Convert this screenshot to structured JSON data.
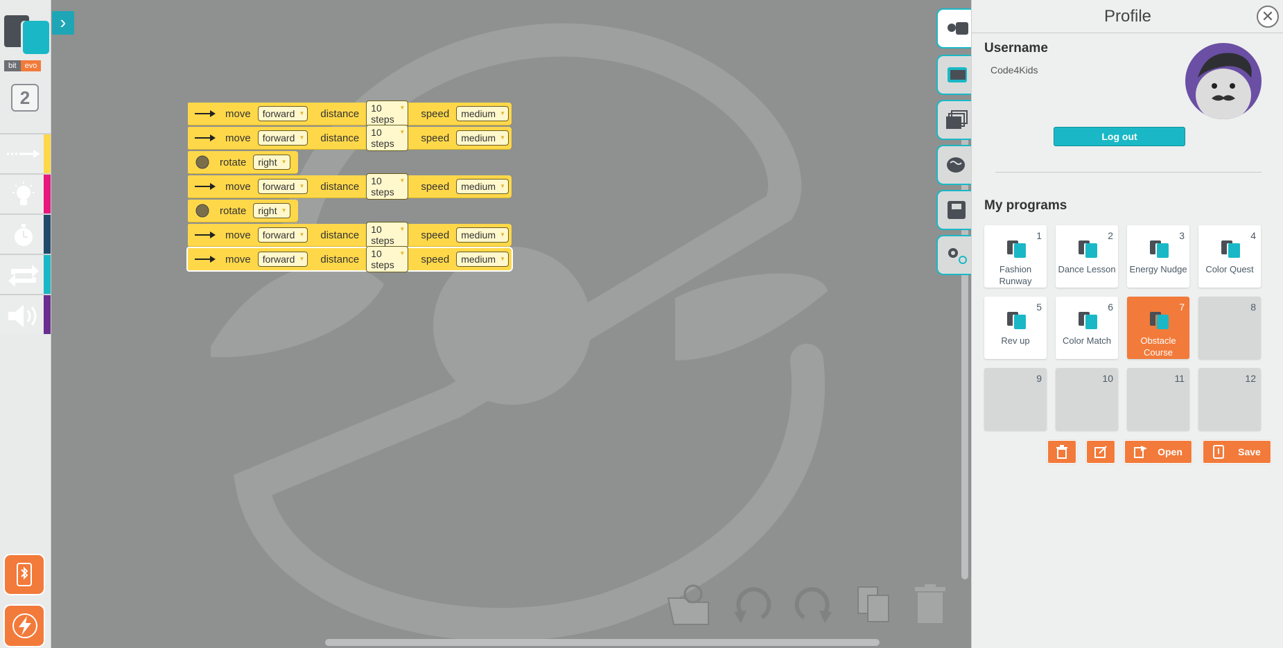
{
  "app": {
    "brand_left": "bit",
    "brand_right": "evo",
    "level": "2"
  },
  "colors": {
    "accent_teal": "#1ab8c6",
    "accent_orange": "#f27a3a",
    "block_yellow": "#ffd84a",
    "canvas_gray": "#8e9190",
    "cat_move": "#ffd84a",
    "cat_light": "#e8167d",
    "cat_timer": "#1f4a6b",
    "cat_loop": "#1ab8c6",
    "cat_sound": "#6b2d8f"
  },
  "categories": [
    {
      "name": "move",
      "icon": "arrow-right-icon"
    },
    {
      "name": "light",
      "icon": "bulb-icon"
    },
    {
      "name": "timer",
      "icon": "stopwatch-icon"
    },
    {
      "name": "loop",
      "icon": "repeat-icon"
    },
    {
      "name": "sound",
      "icon": "speaker-icon"
    }
  ],
  "blocks": [
    {
      "type": "move",
      "cmd": "move",
      "direction": "forward",
      "distance_label": "distance",
      "distance": "10 steps",
      "speed_label": "speed",
      "speed": "medium"
    },
    {
      "type": "move",
      "cmd": "move",
      "direction": "forward",
      "distance_label": "distance",
      "distance": "10 steps",
      "speed_label": "speed",
      "speed": "medium"
    },
    {
      "type": "rotate",
      "cmd": "rotate",
      "direction": "right"
    },
    {
      "type": "move",
      "cmd": "move",
      "direction": "forward",
      "distance_label": "distance",
      "distance": "10 steps",
      "speed_label": "speed",
      "speed": "medium"
    },
    {
      "type": "rotate",
      "cmd": "rotate",
      "direction": "right"
    },
    {
      "type": "move",
      "cmd": "move",
      "direction": "forward",
      "distance_label": "distance",
      "distance": "10 steps",
      "speed_label": "speed",
      "speed": "medium"
    },
    {
      "type": "move",
      "cmd": "move",
      "direction": "forward",
      "distance_label": "distance",
      "distance": "10 steps",
      "speed_label": "speed",
      "speed": "medium"
    }
  ],
  "profile": {
    "title": "Profile",
    "close": "✕",
    "username_label": "Username",
    "username": "Code4Kids",
    "logout": "Log out",
    "programs_title": "My programs",
    "programs": [
      {
        "num": "1",
        "name": "Fashion Runway"
      },
      {
        "num": "2",
        "name": "Dance Lesson"
      },
      {
        "num": "3",
        "name": "Energy Nudge"
      },
      {
        "num": "4",
        "name": "Color Quest"
      },
      {
        "num": "5",
        "name": "Rev up"
      },
      {
        "num": "6",
        "name": "Color Match"
      },
      {
        "num": "7",
        "name": "Obstacle Course",
        "active": true
      },
      {
        "num": "8",
        "name": ""
      },
      {
        "num": "9",
        "name": ""
      },
      {
        "num": "10",
        "name": ""
      },
      {
        "num": "11",
        "name": ""
      },
      {
        "num": "12",
        "name": ""
      }
    ],
    "open_label": "Open",
    "save_label": "Save"
  }
}
